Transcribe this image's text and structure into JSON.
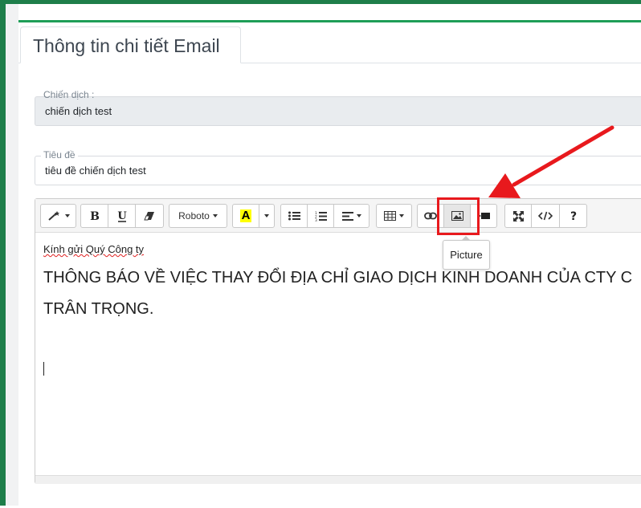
{
  "page": {
    "tab_title": "Thông tin chi tiết Email",
    "campaign": {
      "label": "Chiến dịch :",
      "value": "chiến dịch test"
    },
    "subject": {
      "label": "Tiêu đề",
      "value": "tiêu đề chiến dịch test"
    }
  },
  "editor": {
    "toolbar": {
      "font_name": "Roboto",
      "text_color_letter": "A",
      "icons": [
        "magic-icon",
        "bold-icon",
        "underline-icon",
        "eraser-icon",
        "font-color-icon",
        "unordered-list-icon",
        "ordered-list-icon",
        "align-icon",
        "table-icon",
        "link-icon",
        "picture-icon",
        "video-icon",
        "fullscreen-icon",
        "code-view-icon",
        "help-icon"
      ]
    },
    "content": {
      "greeting": "Kính gửi Quý Công ty",
      "notice": "THÔNG BÁO VỀ VIỆC THAY ĐỔI ĐỊA CHỈ GIAO DỊCH KINH DOANH CỦA CTY C",
      "closing": "TRÂN TRỌNG."
    },
    "tooltip": "Picture"
  },
  "colors": {
    "brand_green": "#1e7e4a",
    "annotation_red": "#e8191d",
    "highlight_yellow": "#ffff00"
  }
}
